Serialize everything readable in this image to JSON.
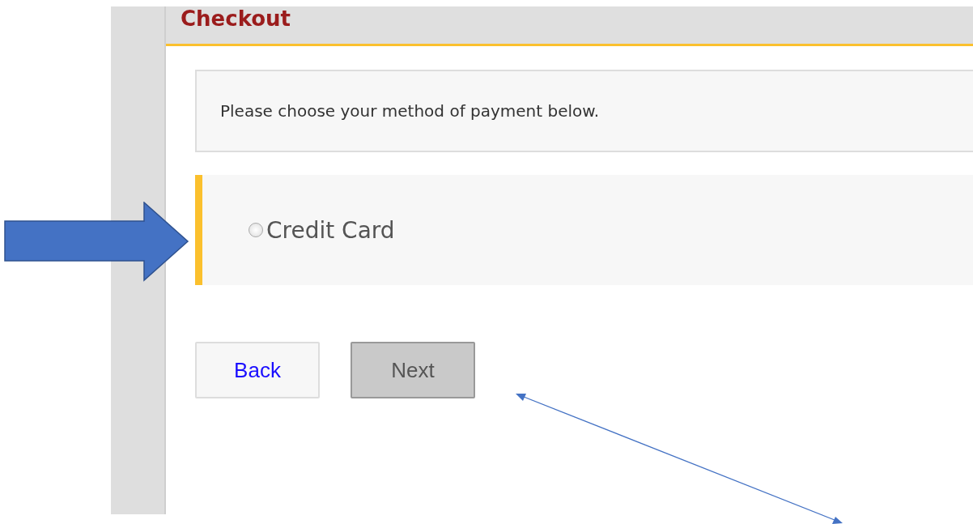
{
  "header": {
    "title": "Checkout"
  },
  "notice": "Please choose your method of payment below.",
  "payment_options": [
    {
      "label": "Credit Card",
      "selected": false
    }
  ],
  "buttons": [
    {
      "label": "Back",
      "disabled": false
    },
    {
      "label": "Next",
      "disabled": true
    }
  ]
}
